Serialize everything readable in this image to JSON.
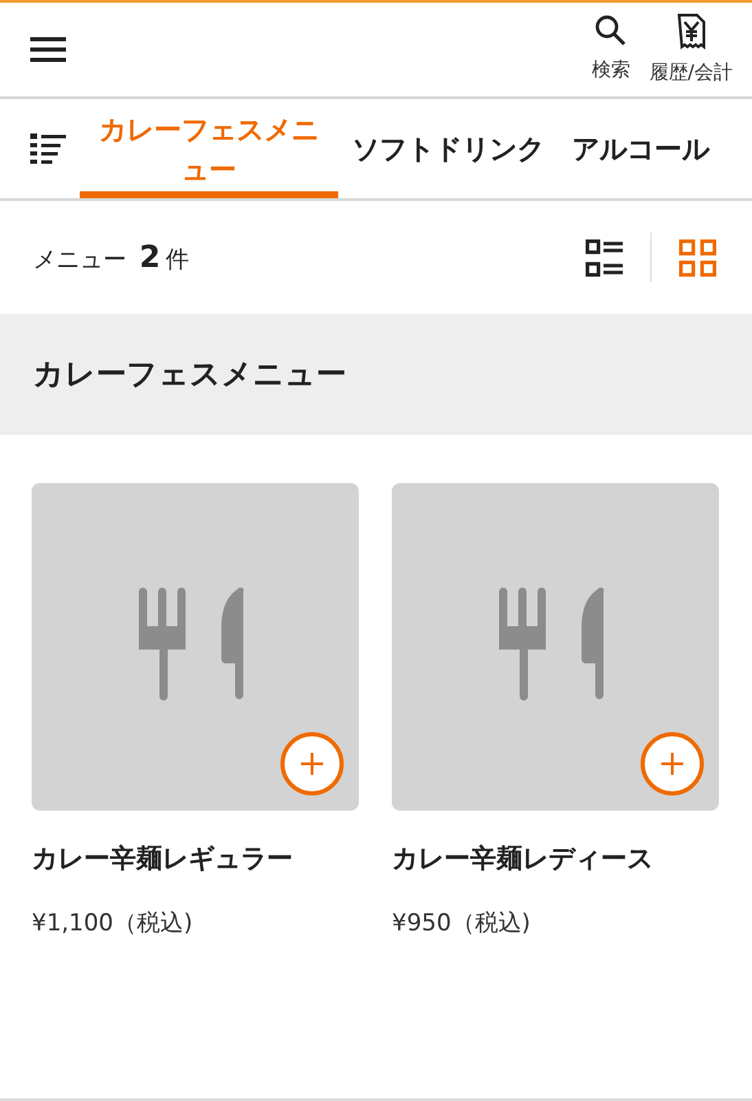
{
  "header": {
    "actions": [
      {
        "kind": "search",
        "label": "検索"
      },
      {
        "kind": "receipt",
        "label": "履歴/会計"
      }
    ]
  },
  "tabs": [
    {
      "label": "カレーフェスメニュー",
      "selected": true
    },
    {
      "label": "ソフトドリンク",
      "selected": false
    },
    {
      "label": "アルコール",
      "selected": false
    }
  ],
  "summary": {
    "count": "メニュー **2**件",
    "views": [
      {
        "kind": "list",
        "selected": false
      },
      {
        "kind": "grid",
        "selected": true
      }
    ]
  },
  "section": {
    "title": "カレーフェスメニュー"
  },
  "items": [
    {
      "name": "カレー辛麺レギュラー",
      "price": "¥1,100（税込)"
    },
    {
      "name": "カレー辛麺レディース",
      "price": "¥950（税込)"
    }
  ]
}
